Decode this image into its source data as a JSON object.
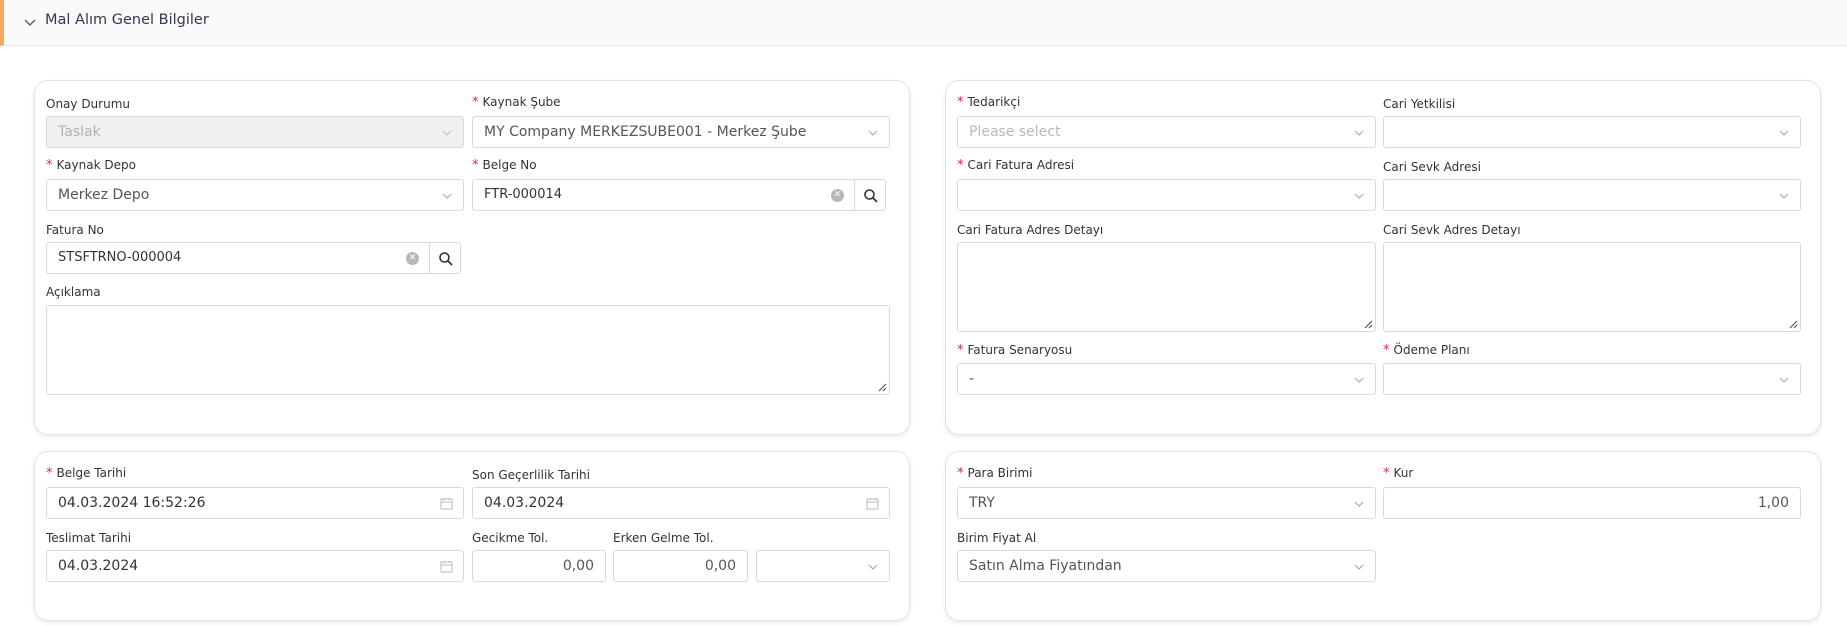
{
  "section": {
    "title": "Mal Alım Genel Bilgiler"
  },
  "left_top": {
    "onay_durumu": {
      "label": "Onay Durumu",
      "value": "Taslak"
    },
    "kaynak_sube": {
      "label": "Kaynak Şube",
      "value": "MY Company MERKEZSUBE001 - Merkez Şube"
    },
    "kaynak_depo": {
      "label": "Kaynak Depo",
      "value": "Merkez Depo"
    },
    "belge_no": {
      "label": "Belge No",
      "value": "FTR-000014"
    },
    "fatura_no": {
      "label": "Fatura No",
      "value": "STSFTRNO-000004"
    },
    "aciklama": {
      "label": "Açıklama",
      "value": ""
    }
  },
  "right_top": {
    "tedarikci": {
      "label": "Tedarikçi",
      "placeholder": "Please select"
    },
    "cari_yetkilisi": {
      "label": "Cari Yetkilisi",
      "value": ""
    },
    "cari_fatura_adresi": {
      "label": "Cari Fatura Adresi",
      "value": ""
    },
    "cari_sevk_adresi": {
      "label": "Cari Sevk Adresi",
      "value": ""
    },
    "cari_fatura_adres_detayi": {
      "label": "Cari Fatura Adres Detayı",
      "value": ""
    },
    "cari_sevk_adres_detayi": {
      "label": "Cari Sevk Adres Detayı",
      "value": ""
    },
    "fatura_senaryosu": {
      "label": "Fatura Senaryosu",
      "value": "-"
    },
    "odeme_plani": {
      "label": "Ödeme Planı",
      "value": ""
    }
  },
  "left_bottom": {
    "belge_tarihi": {
      "label": "Belge Tarihi",
      "value": "04.03.2024 16:52:26"
    },
    "son_gecerlilik_tarihi": {
      "label": "Son Geçerlilik Tarihi",
      "value": "04.03.2024"
    },
    "teslimat_tarihi": {
      "label": "Teslimat Tarihi",
      "value": "04.03.2024"
    },
    "gecikme_tol": {
      "label": "Gecikme Tol.",
      "value": "0,00"
    },
    "erken_gelme_tol": {
      "label": "Erken Gelme Tol.",
      "value": "0,00"
    },
    "tol_unit": {
      "value": ""
    }
  },
  "right_bottom": {
    "para_birimi": {
      "label": "Para Birimi",
      "value": "TRY"
    },
    "kur": {
      "label": "Kur",
      "value": "1,00"
    },
    "birim_fiyat_al": {
      "label": "Birim Fiyat Al",
      "value": "Satın Alma Fiyatından"
    }
  },
  "required_mark": "*"
}
